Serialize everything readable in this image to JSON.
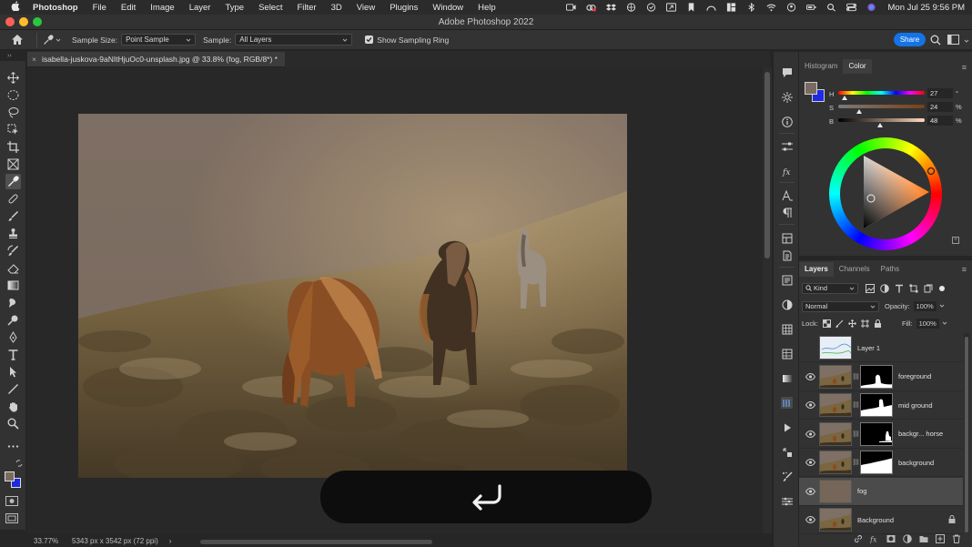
{
  "menubar": {
    "app_name": "Photoshop",
    "items": [
      "File",
      "Edit",
      "Image",
      "Layer",
      "Type",
      "Select",
      "Filter",
      "3D",
      "View",
      "Plugins",
      "Window",
      "Help"
    ],
    "clock": "Mon Jul 25  9:56 PM",
    "status_icons": [
      "screen-record-icon",
      "creative-cloud-icon",
      "dropbox-icon",
      "vpn-icon",
      "copilot-icon",
      "mirror-icon",
      "bookmark-icon",
      "arc-icon",
      "grid-icon",
      "bluetooth-icon",
      "wifi-icon",
      "user-icon",
      "battery-icon",
      "search-icon",
      "control-center-icon",
      "siri-icon"
    ]
  },
  "window": {
    "title": "Adobe Photoshop 2022"
  },
  "options_bar": {
    "sample_size_label": "Sample Size:",
    "sample_size_value": "Point Sample",
    "sample_label": "Sample:",
    "sample_value": "All Layers",
    "show_ring_label": "Show Sampling Ring",
    "show_ring_checked": true,
    "share_label": "Share"
  },
  "document": {
    "tab_title": "isabella-juskova-9aNItHjuOc0-unsplash.jpg @ 33.8% (fog, RGB/8*) *",
    "close_glyph": "×"
  },
  "status_bar": {
    "zoom": "33.77%",
    "dimensions": "5343 px x 3542 px (72 ppi)",
    "arrow": "›"
  },
  "tools": [
    "move-tool",
    "marquee-tool",
    "lasso-tool",
    "object-select-tool",
    "crop-tool",
    "frame-tool",
    "eyedropper-tool",
    "healing-tool",
    "brush-tool",
    "stamp-tool",
    "history-brush-tool",
    "eraser-tool",
    "gradient-tool",
    "blur-tool",
    "dodge-tool",
    "pen-tool",
    "type-tool",
    "path-select-tool",
    "line-tool",
    "hand-tool",
    "zoom-tool",
    "more-tools"
  ],
  "active_tool": "eyedropper-tool",
  "color_panel": {
    "tabs": [
      "Histogram",
      "Color"
    ],
    "active_tab": "Color",
    "foreground": "#7a6b61",
    "background": "#1e2ae0",
    "h": {
      "label": "H",
      "value": "27",
      "unit": "°",
      "fraction": 0.075
    },
    "s": {
      "label": "S",
      "value": "24",
      "unit": "%",
      "fraction": 0.24
    },
    "b": {
      "label": "B",
      "value": "48",
      "unit": "%",
      "fraction": 0.48
    }
  },
  "layers_panel": {
    "tabs": [
      "Layers",
      "Channels",
      "Paths"
    ],
    "active_tab": "Layers",
    "kind_label": "Kind",
    "blend_mode": "Normal",
    "opacity_label": "Opacity:",
    "opacity_value": "100%",
    "lock_label": "Lock:",
    "fill_label": "Fill:",
    "fill_value": "100%",
    "layers": [
      {
        "name": "Layer 1",
        "visible": false,
        "has_mask": false,
        "thumb": "sketch",
        "selected": false,
        "locked": false
      },
      {
        "name": "foreground",
        "visible": true,
        "has_mask": true,
        "mask": "foreground",
        "thumb": "photo",
        "selected": false,
        "locked": false
      },
      {
        "name": "mid ground",
        "visible": true,
        "has_mask": true,
        "mask": "midground",
        "thumb": "photo",
        "selected": false,
        "locked": false
      },
      {
        "name": "backgr... horse",
        "visible": true,
        "has_mask": true,
        "mask": "horse",
        "thumb": "photo",
        "selected": false,
        "locked": false
      },
      {
        "name": "background",
        "visible": true,
        "has_mask": true,
        "mask": "background",
        "thumb": "photo",
        "selected": false,
        "locked": false
      },
      {
        "name": "fog",
        "visible": true,
        "has_mask": false,
        "thumb": "fog",
        "selected": true,
        "locked": false
      },
      {
        "name": "Background",
        "visible": true,
        "has_mask": false,
        "thumb": "photo",
        "selected": false,
        "locked": true
      }
    ],
    "bottom_icons": [
      "link-icon",
      "fx-icon",
      "mask-icon",
      "adjustment-icon",
      "folder-icon",
      "new-layer-icon",
      "trash-icon"
    ]
  },
  "overlay": {
    "icon": "return-arrow-icon"
  }
}
